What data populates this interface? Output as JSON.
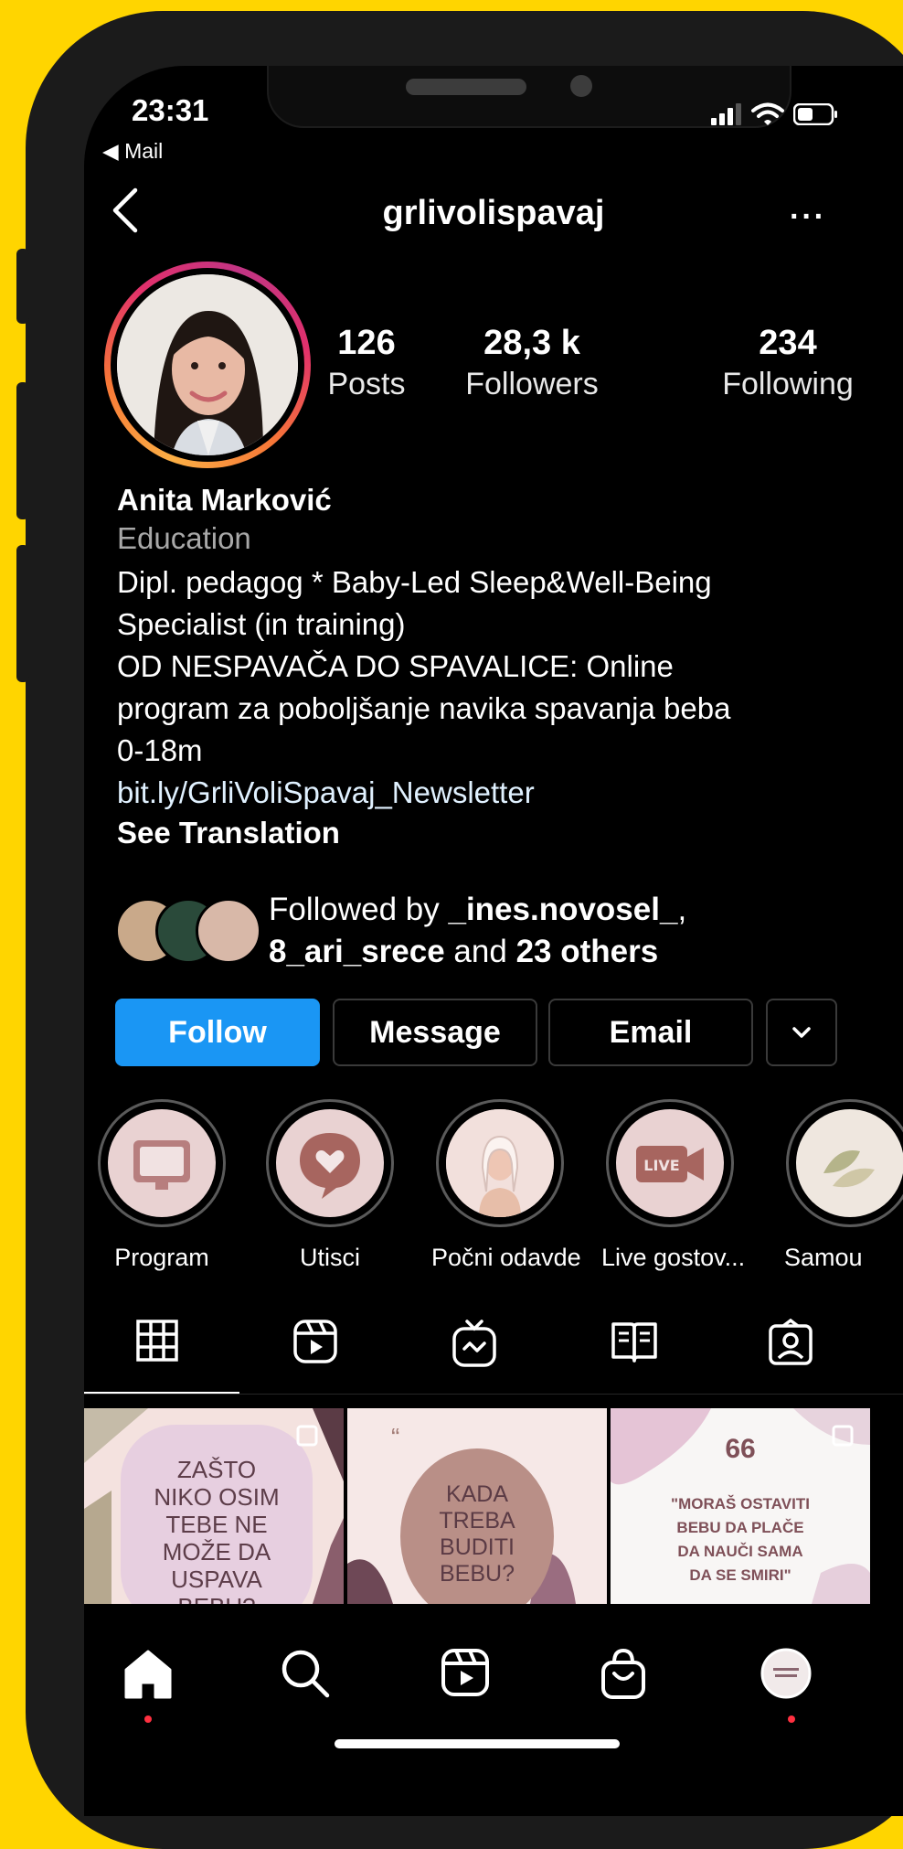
{
  "status_bar": {
    "time": "23:31",
    "back_app": "◀ Mail"
  },
  "header": {
    "username": "grlivolispavaj",
    "more": "···"
  },
  "stats": [
    {
      "value": "126",
      "label": "Posts"
    },
    {
      "value": "28,3 k",
      "label": "Followers"
    },
    {
      "value": "234",
      "label": "Following"
    }
  ],
  "bio": {
    "name": "Anita Marković",
    "category": "Education",
    "line1": "Dipl. pedagog * Baby-Led Sleep&Well-Being",
    "line2": "Specialist (in training)",
    "line3": "OD NESPAVAČA DO SPAVALICE: Online",
    "line4": "program za poboljšanje navika spavanja beba",
    "line5": "0-18m",
    "link": "bit.ly/GrliVoliSpavaj_Newsletter",
    "translate": "See Translation"
  },
  "followed_by": {
    "prefix": "Followed by ",
    "user1": "_ines.novosel_",
    "comma": ",",
    "user2": "8_ari_srece",
    "middle": " and ",
    "others": "23 others"
  },
  "actions": {
    "follow": "Follow",
    "message": "Message",
    "email": "Email",
    "dropdown": "⌄"
  },
  "highlights": [
    {
      "label": "Program"
    },
    {
      "label": "Utisci"
    },
    {
      "label": "Počni odavde"
    },
    {
      "label": "Live gostov..."
    },
    {
      "label": "Samou"
    }
  ],
  "highlight_live_text": "LIVE",
  "posts": [
    {
      "text": "ZAŠTO\nNIKO OSIM\nTEBE NE\nMOŽE DA\nUSPAVA\nBEBU?"
    },
    {
      "quote": "“",
      "text": "KADA\nTREBA\nBUDITI\nBEBU?"
    },
    {
      "quote": "66",
      "text": "\"MORAŠ OSTAVITI\nBEBU DA PLAČE\nDA NAUČI SAMA\nDA SE SMIRI\""
    }
  ],
  "colors": {
    "follow_blue": "#1a96f4",
    "background": "#000000",
    "frame_yellow": "#FFD500",
    "notification_red": "#ff3040"
  }
}
